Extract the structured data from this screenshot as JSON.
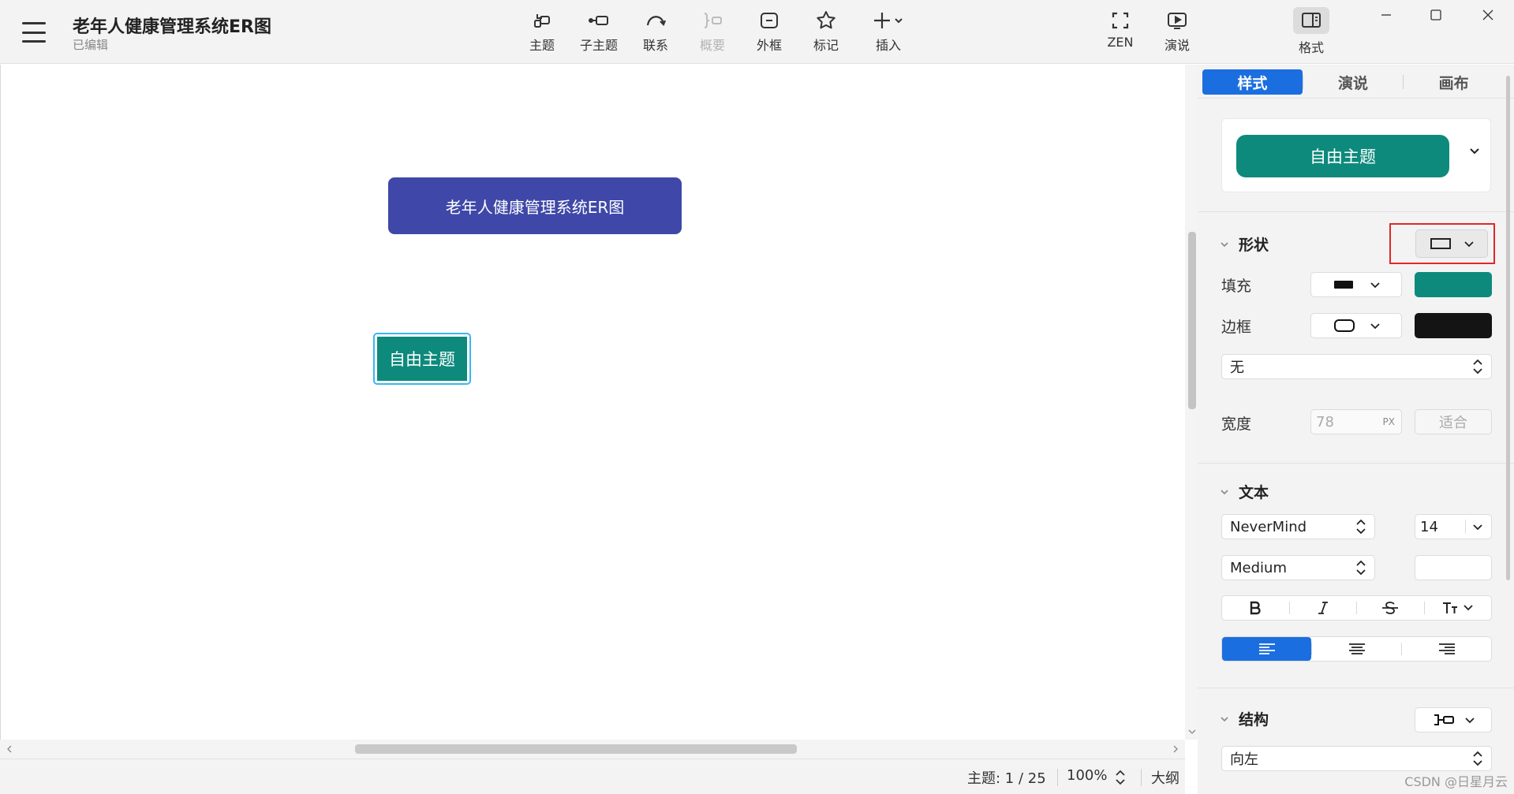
{
  "app": {
    "doc_title": "老年人健康管理系统ER图",
    "doc_status": "已编辑"
  },
  "toolbar": [
    {
      "label": "主题",
      "icon": "topic-icon"
    },
    {
      "label": "子主题",
      "icon": "subtopic-icon"
    },
    {
      "label": "联系",
      "icon": "relationship-icon"
    },
    {
      "label": "概要",
      "icon": "summary-icon",
      "disabled": true
    },
    {
      "label": "外框",
      "icon": "boundary-icon"
    },
    {
      "label": "标记",
      "icon": "star-icon"
    },
    {
      "label": "插入",
      "icon": "plus-icon"
    },
    {
      "label": "ZEN",
      "icon": "fullscreen-icon"
    },
    {
      "label": "演说",
      "icon": "play-icon"
    },
    {
      "label": "格式",
      "icon": "format-panel-icon",
      "active": true
    }
  ],
  "canvas": {
    "main_topic": "老年人健康管理系统ER图",
    "free_topic": "自由主题"
  },
  "status": {
    "topics": "主题: 1 / 25",
    "zoom": "100%",
    "outline": "大纲"
  },
  "panel": {
    "tabs": [
      "样式",
      "演说",
      "画布"
    ],
    "active_tab": 0,
    "style_preview": "自由主题",
    "shape_section": "形状",
    "fill_label": "填充",
    "fill_color": "#0e8a7c",
    "border_label": "边框",
    "border_color": "#141414",
    "border_style_value": "无",
    "width_label": "宽度",
    "width_placeholder": "78",
    "width_unit": "PX",
    "fit_button": "适合",
    "text_section": "文本",
    "font_family": "NeverMind",
    "font_size": "14",
    "font_weight": "Medium",
    "structure_section": "结构",
    "structure_value": "向左"
  },
  "colors": {
    "accent": "#1b6ee0",
    "main_topic_bg": "#3f48a8",
    "free_topic_bg": "#0e8a7c",
    "selection": "#38b8f0",
    "highlight": "#e02828"
  },
  "watermark": "CSDN @日星月云"
}
